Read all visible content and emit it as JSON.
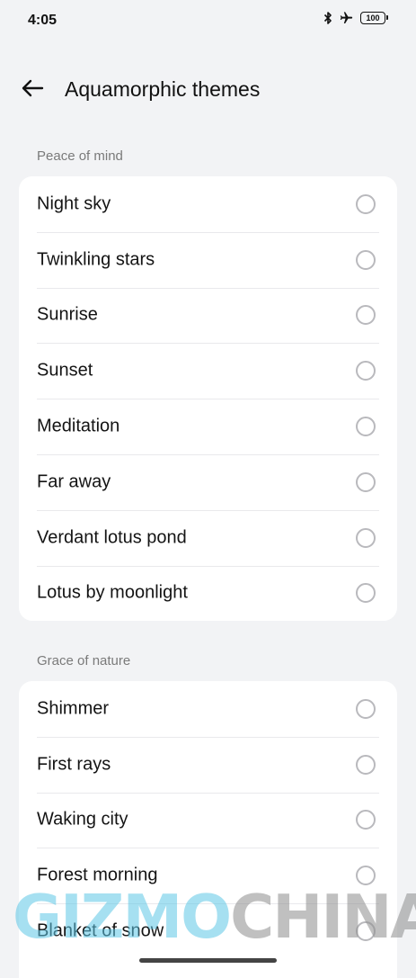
{
  "status_bar": {
    "time": "4:05",
    "icons": [
      "bluetooth-icon",
      "airplane-icon",
      "battery-icon"
    ],
    "battery_level": "100"
  },
  "header": {
    "back_icon": "arrow-left-icon",
    "title": "Aquamorphic themes"
  },
  "sections": [
    {
      "label": "Peace of mind",
      "items": [
        {
          "label": "Night sky",
          "selected": false
        },
        {
          "label": "Twinkling stars",
          "selected": false
        },
        {
          "label": "Sunrise",
          "selected": false
        },
        {
          "label": "Sunset",
          "selected": false
        },
        {
          "label": "Meditation",
          "selected": false
        },
        {
          "label": "Far away",
          "selected": false
        },
        {
          "label": "Verdant lotus pond",
          "selected": false
        },
        {
          "label": "Lotus by moonlight",
          "selected": false
        }
      ]
    },
    {
      "label": "Grace of nature",
      "items": [
        {
          "label": "Shimmer",
          "selected": false
        },
        {
          "label": "First rays",
          "selected": false
        },
        {
          "label": "Waking city",
          "selected": false
        },
        {
          "label": "Forest morning",
          "selected": false
        },
        {
          "label": "Blanket of snow",
          "selected": false
        }
      ]
    }
  ],
  "watermark": {
    "part1": "GIZMO",
    "part2": "CHINA",
    "color1": "#5ec7e6",
    "color2": "#8e8e8e"
  },
  "colors": {
    "background": "#f2f3f5",
    "card": "#ffffff",
    "radio_border": "#b9b9bd"
  }
}
